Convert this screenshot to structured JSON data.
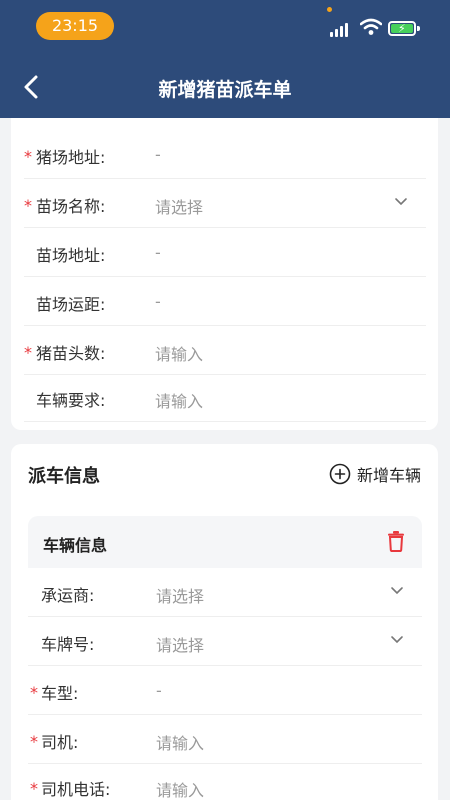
{
  "status_bar": {
    "time": "23:15"
  },
  "nav": {
    "title": "新增猪苗派车单",
    "back_icon": "chevron-left-icon"
  },
  "form": {
    "rows": [
      {
        "required": true,
        "label": "猪场地址:",
        "value": "-",
        "type": "text"
      },
      {
        "required": true,
        "label": "苗场名称:",
        "value": "请选择",
        "type": "select"
      },
      {
        "required": false,
        "label": "苗场地址:",
        "value": "-",
        "type": "text"
      },
      {
        "required": false,
        "label": "苗场运距:",
        "value": "-",
        "type": "text"
      },
      {
        "required": true,
        "label": "猪苗头数:",
        "value": "请输入",
        "type": "input"
      },
      {
        "required": false,
        "label": "车辆要求:",
        "value": "请输入",
        "type": "input"
      }
    ]
  },
  "dispatch": {
    "title": "派车信息",
    "add_vehicle_label": "新增车辆",
    "vehicle": {
      "title": "车辆信息",
      "rows": [
        {
          "required": false,
          "label": "承运商:",
          "value": "请选择",
          "type": "select"
        },
        {
          "required": false,
          "label": "车牌号:",
          "value": "请选择",
          "type": "select"
        },
        {
          "required": true,
          "label": "车型:",
          "value": "-",
          "type": "text"
        },
        {
          "required": true,
          "label": "司机:",
          "value": "请输入",
          "type": "input"
        },
        {
          "required": true,
          "label": "司机电话:",
          "value": "请输入",
          "type": "input"
        }
      ]
    }
  },
  "colors": {
    "header": "#2d4b7a",
    "required": "#e8383d",
    "delete": "#e8383d",
    "time_pill": "#f5a31a"
  },
  "required_mark": "*"
}
